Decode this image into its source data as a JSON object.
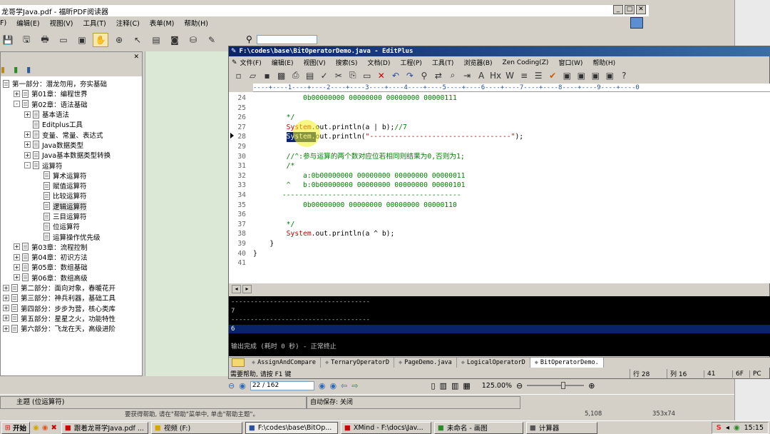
{
  "pdf": {
    "title": "龙哥学Java.pdf - 福昕PDF阅读器",
    "menu": [
      "F)",
      "编辑(E)",
      "视图(V)",
      "工具(T)",
      "注释(C)",
      "表单(M)",
      "帮助(H)"
    ],
    "tree": [
      {
        "label": "第一部分：潜龙勿用，夯实基础",
        "level": 0,
        "pm": ""
      },
      {
        "label": "第01章：编程世界",
        "level": 1,
        "pm": "+"
      },
      {
        "label": "第02章：语法基础",
        "level": 1,
        "pm": "-"
      },
      {
        "label": "基本语法",
        "level": 2,
        "pm": "+"
      },
      {
        "label": "Editplus工具",
        "level": 2,
        "pm": ""
      },
      {
        "label": "变量、常量、表达式",
        "level": 2,
        "pm": "+"
      },
      {
        "label": "Java数据类型",
        "level": 2,
        "pm": "+"
      },
      {
        "label": "Java基本数据类型转换",
        "level": 2,
        "pm": "+"
      },
      {
        "label": "运算符",
        "level": 2,
        "pm": "-"
      },
      {
        "label": "算术运算符",
        "level": 3,
        "pm": ""
      },
      {
        "label": "赋值运算符",
        "level": 3,
        "pm": ""
      },
      {
        "label": "比较运算符",
        "level": 3,
        "pm": ""
      },
      {
        "label": "逻辑运算符",
        "level": 3,
        "pm": "",
        "selected": true
      },
      {
        "label": "三目运算符",
        "level": 3,
        "pm": ""
      },
      {
        "label": "位运算符",
        "level": 3,
        "pm": ""
      },
      {
        "label": "运算操作优先级",
        "level": 3,
        "pm": ""
      },
      {
        "label": "第03章：流程控制",
        "level": 1,
        "pm": "+"
      },
      {
        "label": "第04章：初识方法",
        "level": 1,
        "pm": "+"
      },
      {
        "label": "第05章：数组基础",
        "level": 1,
        "pm": "+"
      },
      {
        "label": "第06章：数组高级",
        "level": 1,
        "pm": "+"
      },
      {
        "label": "第二部分：面向对象，春暖花开",
        "level": 0,
        "pm": "+"
      },
      {
        "label": "第三部分：神兵利器，基础工具",
        "level": 0,
        "pm": "+"
      },
      {
        "label": "第四部分：步步为营，核心类库",
        "level": 0,
        "pm": "+"
      },
      {
        "label": "第五部分：星星之火，功能特性",
        "level": 0,
        "pm": "+"
      },
      {
        "label": "第六部分：飞龙在天，高级进阶",
        "level": 0,
        "pm": "+"
      }
    ],
    "page_current": "22 / 162",
    "zoom": "125.00%",
    "topic_label": "主题 (位运算符)",
    "autosave": "自动保存: 关闭"
  },
  "editplus": {
    "title": "F:\\codes\\base\\BitOperatorDemo.java - EditPlus",
    "menu": [
      "文件(F)",
      "编辑(E)",
      "视图(V)",
      "搜索(S)",
      "文档(D)",
      "工程(P)",
      "工具(T)",
      "浏览器(B)",
      "Zen Coding(Z)",
      "窗口(W)",
      "帮助(H)"
    ],
    "ruler": "----+----1----+----2----+----3----+----4----+----5----+----6----+----7----+----8----+----9----+----0",
    "lines": [
      {
        "n": "24",
        "segs": [
          {
            "t": "            0b00000000 00000000 00000000 00000111",
            "c": "cm"
          }
        ]
      },
      {
        "n": "25",
        "segs": [
          {
            "t": "",
            "c": ""
          }
        ]
      },
      {
        "n": "26",
        "segs": [
          {
            "t": "        */",
            "c": "cm"
          }
        ]
      },
      {
        "n": "27",
        "segs": [
          {
            "t": "        ",
            "c": ""
          },
          {
            "t": "System",
            "c": "kw"
          },
          {
            "t": ".out.println(a | b);",
            "c": ""
          },
          {
            "t": "//7",
            "c": "cm"
          }
        ]
      },
      {
        "n": "28",
        "segs": [
          {
            "t": "        ",
            "c": ""
          },
          {
            "t": "System.",
            "c": "sel"
          },
          {
            "t": "out.println(",
            "c": ""
          },
          {
            "t": "\"----------------------------------\"",
            "c": "str"
          },
          {
            "t": ");",
            "c": ""
          }
        ]
      },
      {
        "n": "29",
        "segs": [
          {
            "t": "",
            "c": ""
          }
        ]
      },
      {
        "n": "30",
        "segs": [
          {
            "t": "        //^:参与运算的两个数对应位若相同则结果为0,否则为1;",
            "c": "cm"
          }
        ]
      },
      {
        "n": "31",
        "segs": [
          {
            "t": "        /*",
            "c": "cm"
          }
        ]
      },
      {
        "n": "32",
        "segs": [
          {
            "t": "            a:0b00000000 00000000 00000000 00000011",
            "c": "cm"
          }
        ]
      },
      {
        "n": "33",
        "segs": [
          {
            "t": "        ^   b:0b00000000 00000000 00000000 00000101",
            "c": "cm"
          }
        ]
      },
      {
        "n": "34",
        "segs": [
          {
            "t": "       -------------------------------------------",
            "c": "cm"
          }
        ]
      },
      {
        "n": "35",
        "segs": [
          {
            "t": "            0b00000000 00000000 00000000 00000110",
            "c": "cm"
          }
        ]
      },
      {
        "n": "36",
        "segs": [
          {
            "t": "",
            "c": ""
          }
        ]
      },
      {
        "n": "37",
        "segs": [
          {
            "t": "        */",
            "c": "cm"
          }
        ]
      },
      {
        "n": "38",
        "segs": [
          {
            "t": "        ",
            "c": ""
          },
          {
            "t": "System",
            "c": "kw"
          },
          {
            "t": ".out.println(a ^ b);",
            "c": ""
          }
        ]
      },
      {
        "n": "39",
        "segs": [
          {
            "t": "    }",
            "c": ""
          }
        ]
      },
      {
        "n": "40",
        "segs": [
          {
            "t": "}",
            "c": ""
          }
        ]
      },
      {
        "n": "41",
        "segs": [
          {
            "t": "",
            "c": ""
          }
        ]
      }
    ],
    "output": [
      {
        "t": "------------------------------------",
        "sel": false
      },
      {
        "t": "7",
        "sel": false
      },
      {
        "t": "------------------------------------",
        "sel": false
      },
      {
        "t": "6",
        "sel": true
      },
      {
        "t": "",
        "sel": false
      },
      {
        "t": "输出完成 (耗时 0 秒) - 正常终止",
        "sel": false
      }
    ],
    "tabs": [
      "AssignAndCompare",
      "TernaryOperatorD",
      "PageDemo.java",
      "LogicalOperatorD",
      "BitOperatorDemo."
    ],
    "status": {
      "help": "需要帮助, 请按 F1 键",
      "line": "行 28",
      "col": "列 16",
      "n41": "41",
      "n6f": "6F",
      "pc": "PC"
    }
  },
  "paint_status": {
    "coords": "5,108",
    "size": "353x74",
    "text": "要获得帮助, 请在\"帮助\"菜单中, 单击\"帮助主题\"。"
  },
  "taskbar": {
    "start": "开始",
    "items": [
      "跟着龙哥学Java.pdf ...",
      "视频 (F:)",
      "F:\\codes\\base\\BitOp...",
      "XMind - F:\\docs\\Jav...",
      "未命名 - 画图",
      "计算器"
    ],
    "clock": "15:15"
  }
}
